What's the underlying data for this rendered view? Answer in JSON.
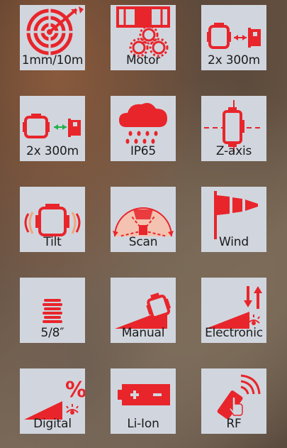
{
  "accent_color": "#e8252b",
  "tile_color": "#d1d6de",
  "features": [
    {
      "label": "1mm/10m",
      "icon": "target-arrow-icon"
    },
    {
      "label": "Motor",
      "icon": "motor-gears-icon"
    },
    {
      "label": "2x 300m",
      "icon": "laser-receiver-range-icon"
    },
    {
      "label": "2x 300m",
      "icon": "laser-receiver-green-range-icon"
    },
    {
      "label": "IP65",
      "icon": "rain-cloud-icon"
    },
    {
      "label": "Z-axis",
      "icon": "z-axis-icon"
    },
    {
      "label": "Tilt",
      "icon": "tilt-icon"
    },
    {
      "label": "Scan",
      "icon": "scan-icon"
    },
    {
      "label": "Wind",
      "icon": "wind-flag-icon"
    },
    {
      "label": "5/8″",
      "icon": "thread-screw-icon"
    },
    {
      "label": "Manual",
      "icon": "manual-slope-icon"
    },
    {
      "label": "Electronic",
      "icon": "electronic-slope-icon"
    },
    {
      "label": "Digital",
      "icon": "digital-slope-icon"
    },
    {
      "label": "Li-Ion",
      "icon": "battery-icon"
    },
    {
      "label": "RF",
      "icon": "rf-remote-icon"
    }
  ]
}
